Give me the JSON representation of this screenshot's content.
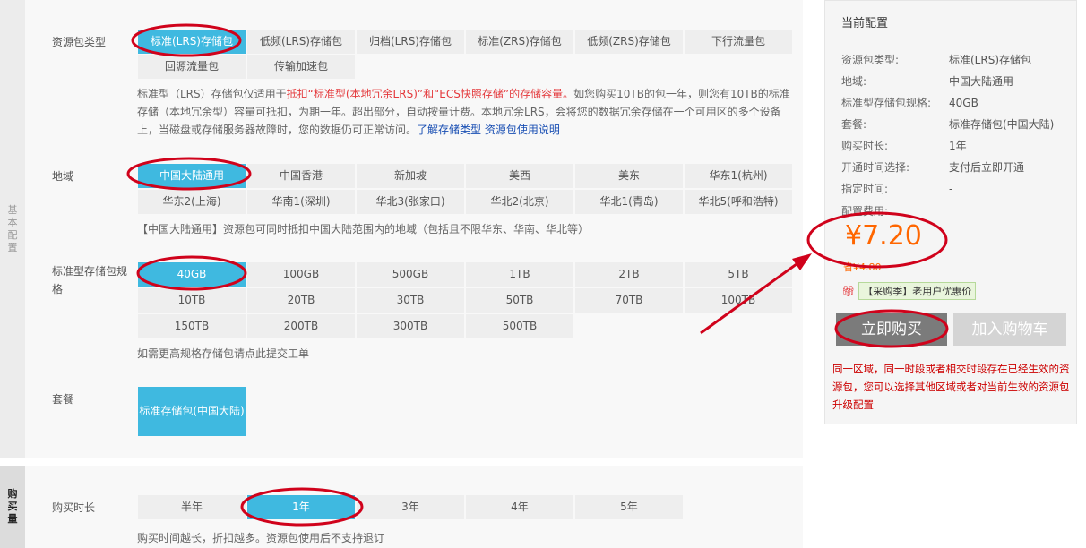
{
  "rails": {
    "basic": [
      "基",
      "本",
      "配",
      "置"
    ],
    "buy": [
      "购",
      "买",
      "量"
    ]
  },
  "package_type": {
    "label": "资源包类型",
    "options": [
      "标准(LRS)存储包",
      "低频(LRS)存储包",
      "归档(LRS)存储包",
      "标准(ZRS)存储包",
      "低频(ZRS)存储包",
      "下行流量包",
      "回源流量包",
      "传输加速包"
    ],
    "selected": 0,
    "desc_parts": {
      "p1": "标准型（LRS）存储包仅适用于",
      "p2_red": "抵扣“标准型(本地冗余LRS)”和“ECS快照存储”的存储容量。",
      "p3": "如您购买10TB的包一年，则您有10TB的标准存储（本地冗余型）容量可抵扣，为期一年。超出部分，自动按量计费。本地冗余LRS，会将您的数据冗余存储在一个可用区的多个设备上，当磁盘或存储服务器故障时，您的数据仍可正常访问。",
      "link1": "了解存储类型",
      "link2": "资源包使用说明"
    }
  },
  "region": {
    "label": "地域",
    "options": [
      "中国大陆通用",
      "中国香港",
      "新加坡",
      "美西",
      "美东",
      "华东1(杭州)",
      "华东2(上海)",
      "华南1(深圳)",
      "华北3(张家口)",
      "华北2(北京)",
      "华北1(青岛)",
      "华北5(呼和浩特)"
    ],
    "selected": 0,
    "desc": "【中国大陆通用】资源包可同时抵扣中国大陆范围内的地域（包括且不限华东、华南、华北等）"
  },
  "spec": {
    "label": "标准型存储包规格",
    "options": [
      "40GB",
      "100GB",
      "500GB",
      "1TB",
      "2TB",
      "5TB",
      "10TB",
      "20TB",
      "30TB",
      "50TB",
      "70TB",
      "100TB",
      "150TB",
      "200TB",
      "300TB",
      "500TB"
    ],
    "selected": 0,
    "desc": "如需更高规格存储包请点此提交工单"
  },
  "package": {
    "label": "套餐",
    "option": "标准存储包(中国大陆)"
  },
  "duration": {
    "label": "购买时长",
    "options": [
      "半年",
      "1年",
      "3年",
      "4年",
      "5年"
    ],
    "selected": 1,
    "desc": "购买时间越长，折扣越多。资源包使用后不支持退订"
  },
  "summary": {
    "title": "当前配置",
    "rows": [
      {
        "k": "资源包类型:",
        "v": "标准(LRS)存储包"
      },
      {
        "k": "地域:",
        "v": "中国大陆通用"
      },
      {
        "k": "标准型存储包规格:",
        "v": "40GB"
      },
      {
        "k": "套餐:",
        "v": "标准存储包(中国大陆)"
      },
      {
        "k": "购买时长:",
        "v": "1年"
      },
      {
        "k": "开通时间选择:",
        "v": "支付后立即开通"
      },
      {
        "k": "指定时间:",
        "v": "-"
      },
      {
        "k": "配置费用:",
        "v": ""
      }
    ],
    "price": "¥7.20",
    "save": "省¥4.80",
    "promo_icon": "gift-icon",
    "promo": "【采购季】老用户优惠价",
    "buy_label": "立即购买",
    "cart_label": "加入购物车",
    "warning": "同一区域，同一时段或者相交时段存在已经生效的资源包，您可以选择其他区域或者对当前生效的资源包升级配置"
  },
  "colors": {
    "selected": "#3fb9e0",
    "annotation": "#d0021b",
    "price": "#ff6600"
  }
}
